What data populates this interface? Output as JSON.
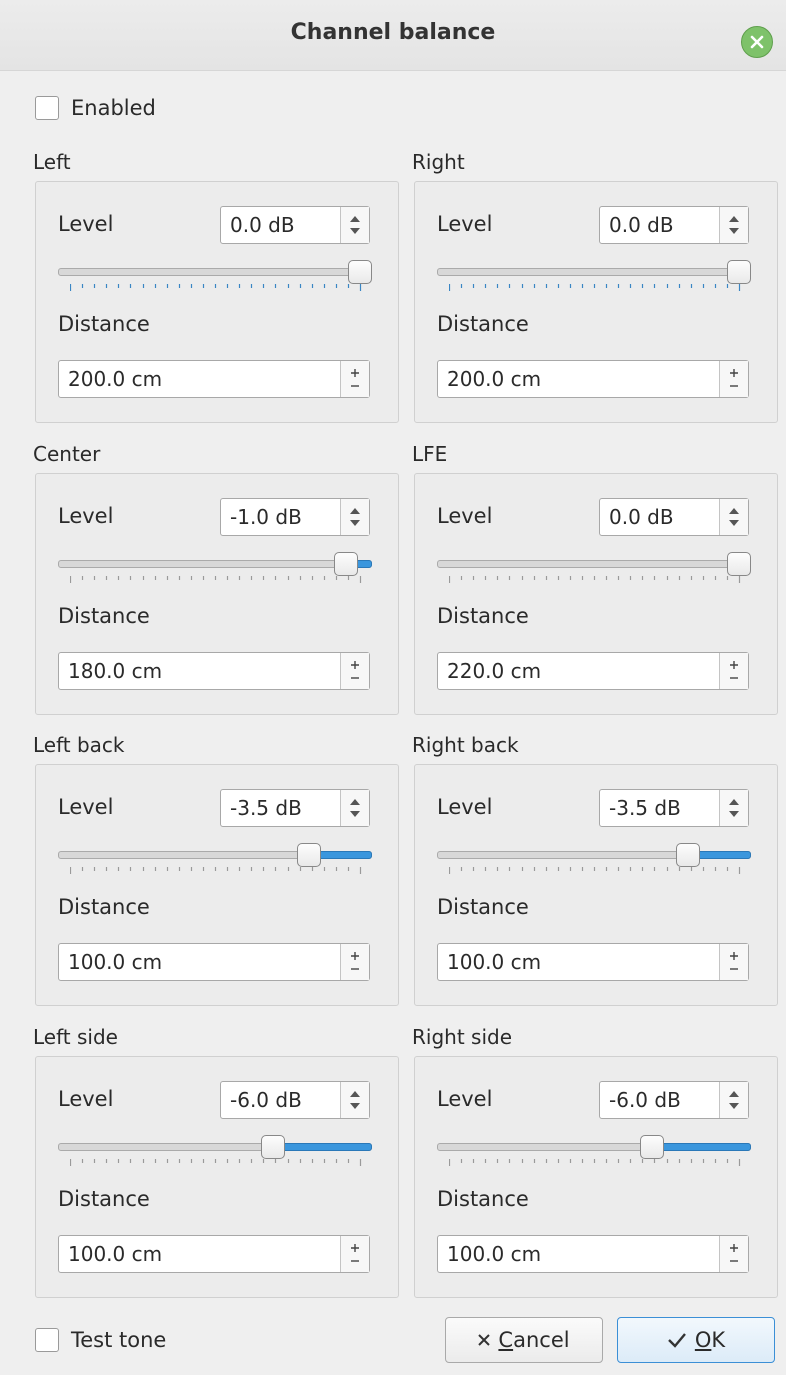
{
  "window": {
    "title": "Channel balance",
    "close_icon": "close-icon",
    "close_color": "#7ec26a"
  },
  "enabled": {
    "label": "Enabled",
    "checked": false
  },
  "level_label": "Level",
  "distance_label": "Distance",
  "accent": "#3a96dd",
  "channels": [
    {
      "title": "Left",
      "level": "0.0 dB",
      "level_fraction": 1.0,
      "distance": "200.0 cm"
    },
    {
      "title": "Right",
      "level": "0.0 dB",
      "level_fraction": 1.0,
      "distance": "200.0 cm"
    },
    {
      "title": "Center",
      "level": "-1.0 dB",
      "level_fraction": 0.95,
      "distance": "180.0 cm"
    },
    {
      "title": "LFE",
      "level": "0.0 dB",
      "level_fraction": 1.0,
      "distance": "220.0 cm"
    },
    {
      "title": "Left back",
      "level": "-3.5 dB",
      "level_fraction": 0.825,
      "distance": "100.0 cm"
    },
    {
      "title": "Right back",
      "level": "-3.5 dB",
      "level_fraction": 0.825,
      "distance": "100.0 cm"
    },
    {
      "title": "Left side",
      "level": "-6.0 dB",
      "level_fraction": 0.7,
      "distance": "100.0 cm"
    },
    {
      "title": "Right side",
      "level": "-6.0 dB",
      "level_fraction": 0.7,
      "distance": "100.0 cm"
    }
  ],
  "test_tone": {
    "label": "Test tone",
    "checked": false
  },
  "buttons": {
    "cancel": {
      "icon": "x-icon",
      "mnemonic": "C",
      "rest": "ancel"
    },
    "ok": {
      "icon": "checkmark-icon",
      "mnemonic": "O",
      "rest": "K"
    }
  }
}
